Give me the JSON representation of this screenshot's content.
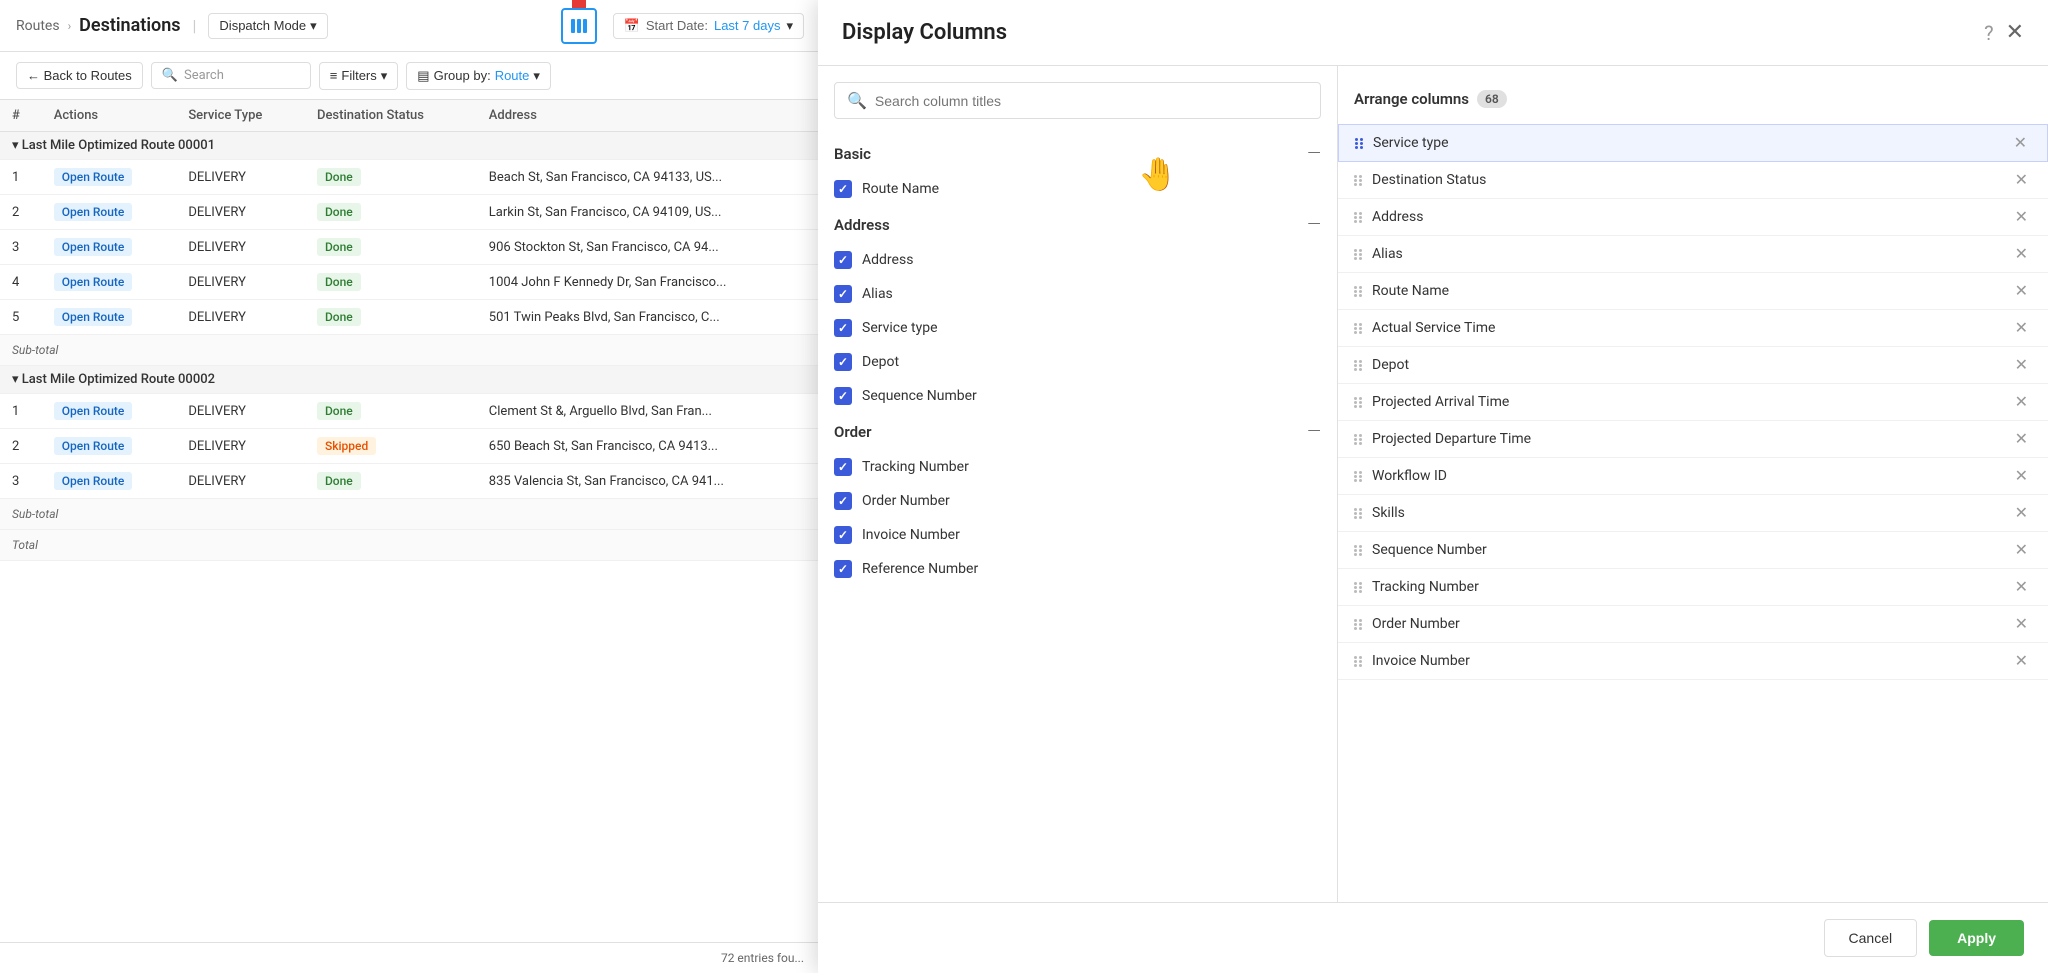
{
  "breadcrumb": {
    "parent": "Routes",
    "current": "Destinations",
    "dispatch_mode": "Dispatch Mode",
    "start_date_label": "Start Date:",
    "start_date_value": "Last 7 days"
  },
  "toolbar": {
    "back_label": "← Back to Routes",
    "search_placeholder": "Search",
    "filters_label": "Filters",
    "group_by_label": "Group by:",
    "group_by_value": "Route"
  },
  "table": {
    "headers": [
      "#",
      "Actions",
      "Service Type",
      "Destination Status",
      "Address"
    ],
    "route1_name": "Last Mile Optimized Route 00001",
    "route2_name": "Last Mile Optimized Route 00002",
    "rows_route1": [
      {
        "num": "1",
        "action": "Open Route",
        "service": "DELIVERY",
        "status": "Done",
        "address": "Beach St, San Francisco, CA 94133, US..."
      },
      {
        "num": "2",
        "action": "Open Route",
        "service": "DELIVERY",
        "status": "Done",
        "address": "Larkin St, San Francisco, CA 94109, US..."
      },
      {
        "num": "3",
        "action": "Open Route",
        "service": "DELIVERY",
        "status": "Done",
        "address": "906 Stockton St, San Francisco, CA 94..."
      },
      {
        "num": "4",
        "action": "Open Route",
        "service": "DELIVERY",
        "status": "Done",
        "address": "1004 John F Kennedy Dr, San Francisco..."
      },
      {
        "num": "5",
        "action": "Open Route",
        "service": "DELIVERY",
        "status": "Done",
        "address": "501 Twin Peaks Blvd, San Francisco, C..."
      }
    ],
    "subtotal1": "Sub-total",
    "rows_route2": [
      {
        "num": "1",
        "action": "Open Route",
        "service": "DELIVERY",
        "status": "Done",
        "address": "Clement St &, Arguello Blvd, San Fran..."
      },
      {
        "num": "2",
        "action": "Open Route",
        "service": "DELIVERY",
        "status": "Skipped",
        "address": "650 Beach St, San Francisco, CA 9413..."
      },
      {
        "num": "3",
        "action": "Open Route",
        "service": "DELIVERY",
        "status": "Done",
        "address": "835 Valencia St, San Francisco, CA 941..."
      }
    ],
    "subtotal2": "Sub-total",
    "total": "Total",
    "entries": "72 entries fou..."
  },
  "panel": {
    "title": "Display Columns",
    "search_placeholder": "Search column titles",
    "arrange_title": "Arrange columns",
    "arrange_count": "68",
    "sections": {
      "basic": {
        "label": "Basic",
        "items": [
          {
            "label": "Route Name",
            "checked": true
          }
        ]
      },
      "address": {
        "label": "Address",
        "items": [
          {
            "label": "Address",
            "checked": true
          },
          {
            "label": "Alias",
            "checked": true
          },
          {
            "label": "Service type",
            "checked": true
          },
          {
            "label": "Depot",
            "checked": true
          },
          {
            "label": "Sequence Number",
            "checked": true
          }
        ]
      },
      "order": {
        "label": "Order",
        "items": [
          {
            "label": "Tracking Number",
            "checked": true
          },
          {
            "label": "Order Number",
            "checked": true
          },
          {
            "label": "Invoice Number",
            "checked": true
          },
          {
            "label": "Reference Number",
            "checked": true
          }
        ]
      }
    },
    "arranged_columns": [
      {
        "label": "Service type",
        "dragging": true
      },
      {
        "label": "Destination Status",
        "dragging": false
      },
      {
        "label": "Address",
        "dragging": false
      },
      {
        "label": "Alias",
        "dragging": false
      },
      {
        "label": "Route Name",
        "dragging": false
      },
      {
        "label": "Actual Service Time",
        "dragging": false
      },
      {
        "label": "Depot",
        "dragging": false
      },
      {
        "label": "Projected Arrival Time",
        "dragging": false
      },
      {
        "label": "Projected Departure Time",
        "dragging": false
      },
      {
        "label": "Workflow ID",
        "dragging": false
      },
      {
        "label": "Skills",
        "dragging": false
      },
      {
        "label": "Sequence Number",
        "dragging": false
      },
      {
        "label": "Tracking Number",
        "dragging": false
      },
      {
        "label": "Order Number",
        "dragging": false
      },
      {
        "label": "Invoice Number",
        "dragging": false
      }
    ],
    "cancel_label": "Cancel",
    "apply_label": "Apply"
  }
}
